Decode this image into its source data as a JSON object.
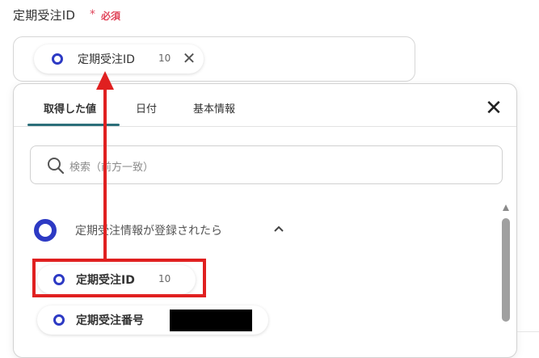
{
  "field": {
    "label": "定期受注ID",
    "required_star": "*",
    "required_text": "必須",
    "selected_chip": {
      "name": "定期受注ID",
      "count": "10",
      "remove_icon": "close-icon"
    }
  },
  "dropdown": {
    "tabs": [
      {
        "label": "取得した値",
        "active": true
      },
      {
        "label": "日付",
        "active": false
      },
      {
        "label": "基本情報",
        "active": false
      }
    ],
    "close_icon": "close-icon",
    "search": {
      "placeholder": "検索（前方一致）",
      "icon": "search-icon"
    },
    "group": {
      "label": "定期受注情報が登録されたら",
      "icon": "ring-icon",
      "caret_icon": "chevron-up-icon",
      "items": [
        {
          "name": "定期受注ID",
          "count": "10"
        },
        {
          "name": "定期受注番号",
          "count": ""
        }
      ]
    }
  },
  "colors": {
    "accent_blue": "#2d3ac4",
    "required_red": "#e0455a",
    "annotation_red": "#e02020",
    "tab_underline": "#2c6f7a"
  }
}
